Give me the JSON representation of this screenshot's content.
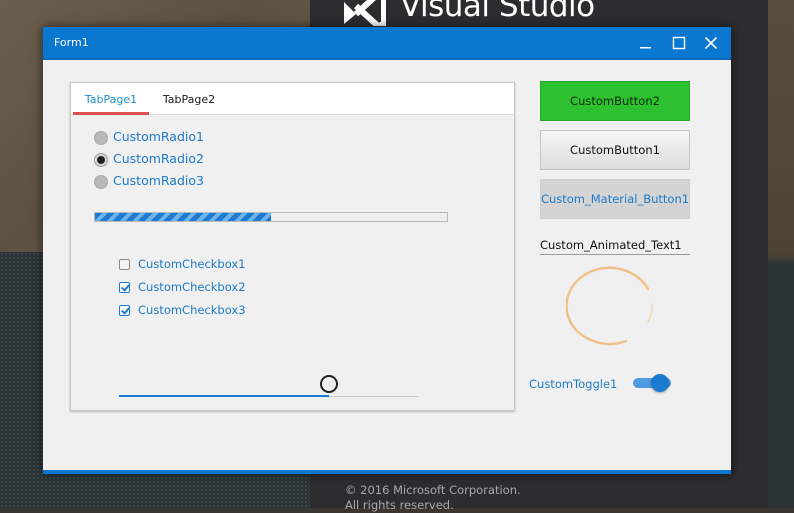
{
  "background": {
    "splash_title": "Visual Studio",
    "copyright_line1": "© 2016 Microsoft Corporation.",
    "copyright_line2": "All rights reserved."
  },
  "window": {
    "title": "Form1",
    "controls": [
      "minimize-icon",
      "maximize-icon",
      "close-icon"
    ],
    "accent_color": "#0b78d0"
  },
  "tabs": [
    {
      "label": "TabPage1",
      "active": true
    },
    {
      "label": "TabPage2",
      "active": false
    }
  ],
  "radios": [
    {
      "label": "CustomRadio1",
      "checked": false
    },
    {
      "label": "CustomRadio2",
      "checked": true
    },
    {
      "label": "CustomRadio3",
      "checked": false
    }
  ],
  "progress": {
    "value": 0.5
  },
  "checkboxes": [
    {
      "label": "CustomCheckbox1",
      "checked": false
    },
    {
      "label": "CustomCheckbox2",
      "checked": true
    },
    {
      "label": "CustomCheckbox3",
      "checked": true
    }
  ],
  "slider": {
    "value": 0.7
  },
  "buttons": {
    "custom_button2": "CustomButton2",
    "custom_button1": "CustomButton1",
    "material_button": "Custom_Material_Button1"
  },
  "animated_text": {
    "value": "Custom_Animated_Text1"
  },
  "toggle": {
    "label": "CustomToggle1",
    "on": true
  },
  "colors": {
    "green_button": "#2ec12f",
    "link_blue": "#1e7ac6",
    "tab_underline": "#e05050",
    "spinner": "#f0c08a"
  }
}
